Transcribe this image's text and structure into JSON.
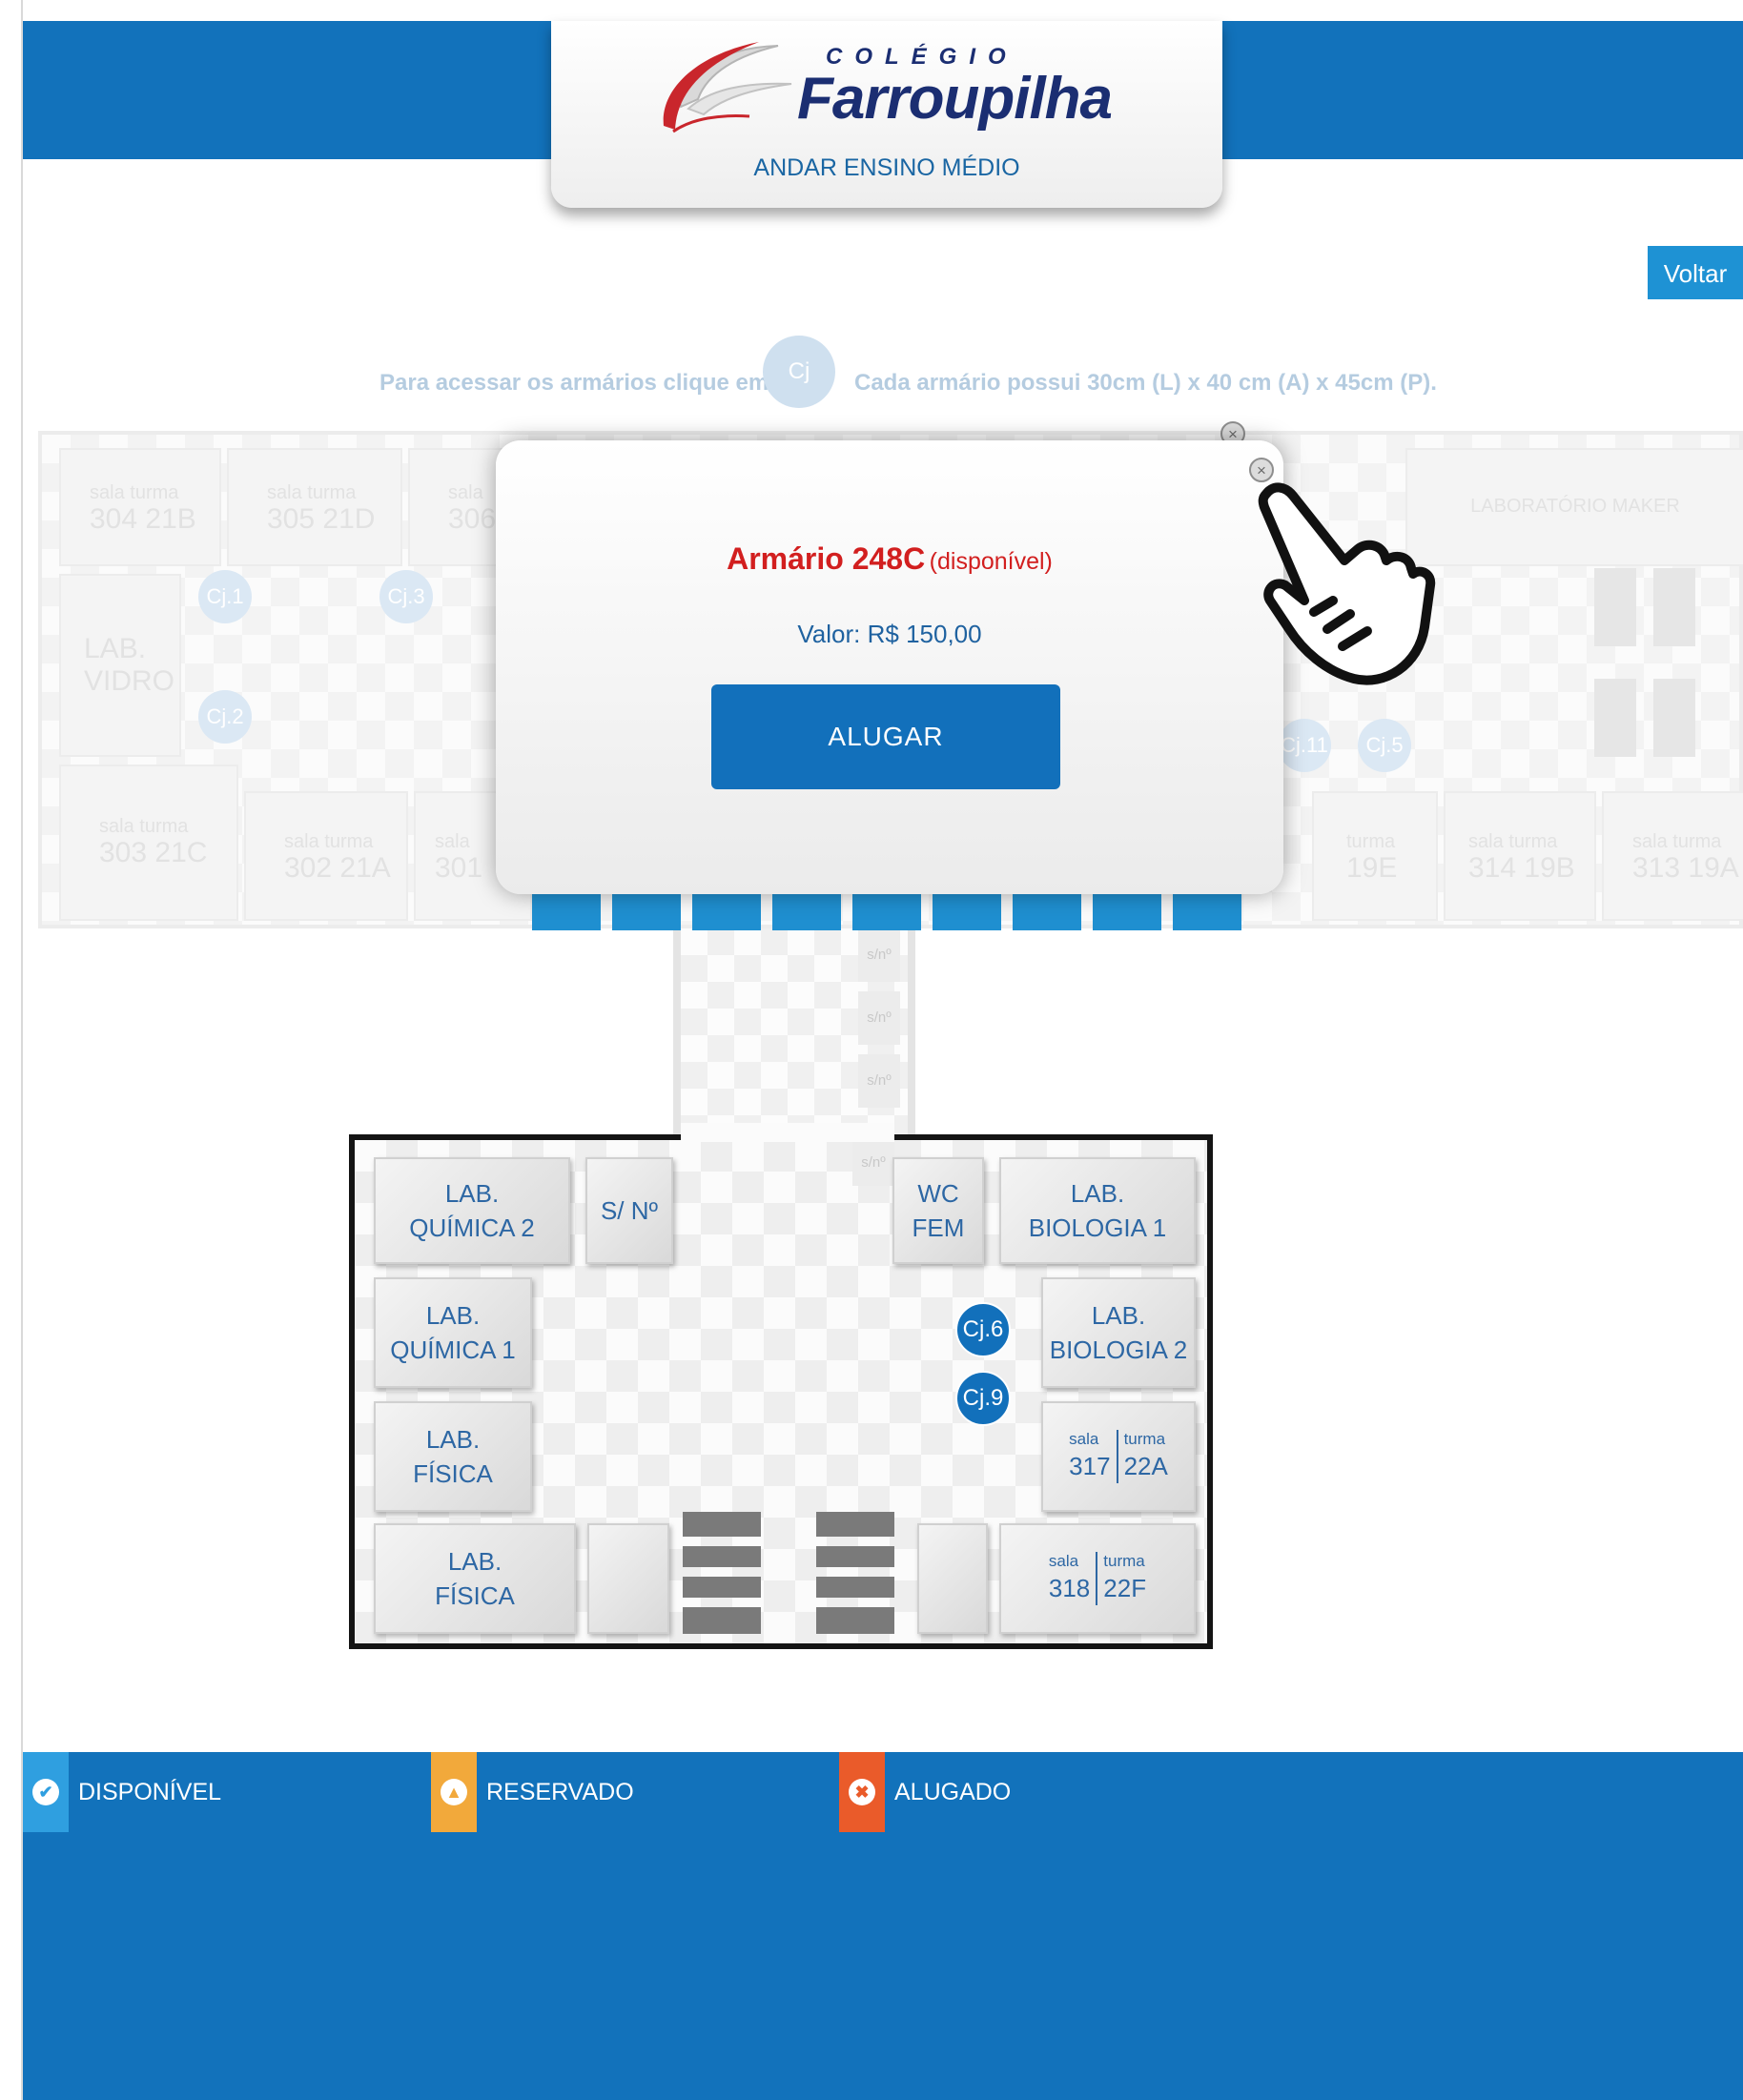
{
  "header": {
    "logo_small": "COLÉGIO",
    "logo_name": "Farroupilha",
    "subtitle": "ANDAR ENSINO MÉDIO"
  },
  "nav": {
    "back_label": "Voltar"
  },
  "instructions": {
    "prefix": "Para acessar os armários clique em",
    "cj_label": "Cj",
    "size_info": "Cada armário possui 30cm (L) x 40 cm (A) x 45cm (P)."
  },
  "upper_floor": {
    "rooms": [
      {
        "sala": "304",
        "turma": "21B"
      },
      {
        "sala": "305",
        "turma": "21D"
      },
      {
        "sala": "306",
        "turma": ""
      },
      {
        "sala": "303",
        "turma": "21C"
      },
      {
        "sala": "302",
        "turma": "21A"
      },
      {
        "sala": "301",
        "turma": ""
      },
      {
        "sala": "",
        "turma": "19E"
      },
      {
        "sala": "314",
        "turma": "19B"
      },
      {
        "sala": "313",
        "turma": "19A"
      }
    ],
    "lab_vidro": "LAB. VIDRO",
    "lab_maker": "LABORATÓRIO MAKER",
    "cj_markers": [
      "Cj.1",
      "Cj.2",
      "Cj.3",
      "Cj.11",
      "Cj.5"
    ],
    "sala_label": "sala",
    "turma_label": "turma"
  },
  "corridor": {
    "sn_tags": [
      "s/nº",
      "s/nº",
      "s/nº",
      "s/nº"
    ]
  },
  "lower_floor": {
    "lab_quimica_2": [
      "LAB.",
      "QUÍMICA 2"
    ],
    "sem_numero": "S/ Nº",
    "wc_fem": [
      "WC",
      "FEM"
    ],
    "lab_biologia_1": [
      "LAB.",
      "BIOLOGIA 1"
    ],
    "lab_quimica_1": [
      "LAB.",
      "QUÍMICA 1"
    ],
    "lab_biologia_2": [
      "LAB.",
      "BIOLOGIA 2"
    ],
    "lab_fisica_a": [
      "LAB.",
      "FÍSICA"
    ],
    "lab_fisica_b": [
      "LAB.",
      "FÍSICA"
    ],
    "sala_317": {
      "sala": "317",
      "turma": "22A"
    },
    "sala_318": {
      "sala": "318",
      "turma": "22F"
    },
    "cj_markers": [
      "Cj.6",
      "Cj.9"
    ]
  },
  "modal": {
    "title": "Armário 248C",
    "status": "(disponível)",
    "price": "Valor: R$ 150,00",
    "action": "ALUGAR",
    "close_icon": "×"
  },
  "legend": [
    {
      "label": "DISPONÍVEL",
      "color": "#2f9fe0",
      "icon": "✔"
    },
    {
      "label": "RESERVADO",
      "color": "#f2a93b",
      "icon": "▲"
    },
    {
      "label": "ALUGADO",
      "color": "#ea5b2a",
      "icon": "✖"
    }
  ],
  "colors": {
    "brand_blue": "#1272bb",
    "accent_red": "#d21f1f"
  }
}
